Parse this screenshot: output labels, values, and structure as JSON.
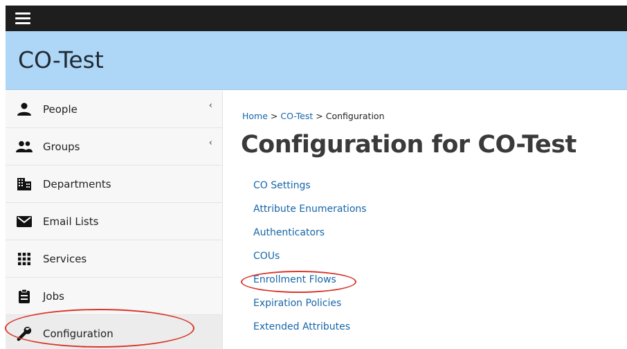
{
  "header": {
    "menu_icon": "hamburger-icon",
    "co_name": "CO-Test"
  },
  "sidebar": {
    "items": [
      {
        "label": "People",
        "icon": "person-icon",
        "has_submenu": true
      },
      {
        "label": "Groups",
        "icon": "groups-icon",
        "has_submenu": true
      },
      {
        "label": "Departments",
        "icon": "building-icon",
        "has_submenu": false
      },
      {
        "label": "Email Lists",
        "icon": "envelope-icon",
        "has_submenu": false
      },
      {
        "label": "Services",
        "icon": "grid-icon",
        "has_submenu": false
      },
      {
        "label": "Jobs",
        "icon": "clipboard-icon",
        "has_submenu": false
      },
      {
        "label": "Configuration",
        "icon": "wrench-icon",
        "has_submenu": false,
        "active": true
      }
    ],
    "chevron": "‹"
  },
  "breadcrumb": {
    "home": "Home",
    "sep": ">",
    "co": "CO-Test",
    "current": "Configuration"
  },
  "main": {
    "title": "Configuration for CO-Test",
    "links": [
      "CO Settings",
      "Attribute Enumerations",
      "Authenticators",
      "COUs",
      "Enrollment Flows",
      "Expiration Policies",
      "Extended Attributes"
    ]
  },
  "colors": {
    "topbar": "#1e1e1e",
    "co_bar": "#aed6f6",
    "link": "#1565a8",
    "annotation": "#d9362b"
  }
}
